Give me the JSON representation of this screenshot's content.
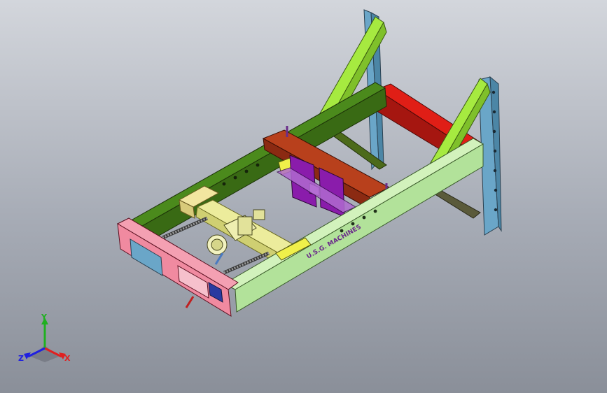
{
  "colors": {
    "background_top": "#d3d6dc",
    "background_bottom": "#8a8f99",
    "side_rail_green": "#3f6e16",
    "front_rail_lightgreen": "#b9e6a0",
    "brace_lime": "#9ce03a",
    "column_blue": "#6aa6c8",
    "rear_beam_red": "#c11a12",
    "carriage_brown": "#8b2a12",
    "clamp_purple": "#8a1cab",
    "slide_khaki": "#e5e59a",
    "front_plate_pink": "#f08aa0",
    "yellow_strip": "#f0f04a",
    "axis_x": "#e02020",
    "axis_y": "#20b020",
    "axis_z": "#2020e0"
  },
  "model": {
    "rail_text": "U.S.G. MACHINES"
  },
  "triad": {
    "x_label": "X",
    "y_label": "Y",
    "z_label": "Z"
  }
}
